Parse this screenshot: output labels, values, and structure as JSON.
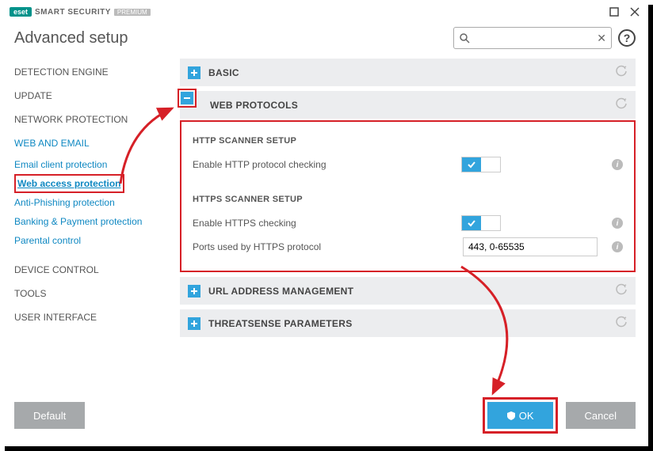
{
  "brand": {
    "badge": "eset",
    "name": "SMART SECURITY",
    "edition": "PREMIUM"
  },
  "page_title": "Advanced setup",
  "search": {
    "placeholder": ""
  },
  "sidebar": {
    "main": [
      "DETECTION ENGINE",
      "UPDATE",
      "NETWORK PROTECTION",
      "WEB AND EMAIL"
    ],
    "subs": [
      "Email client protection",
      "Web access protection",
      "Anti-Phishing protection",
      "Banking & Payment protection",
      "Parental control"
    ],
    "main2": [
      "DEVICE CONTROL",
      "TOOLS",
      "USER INTERFACE"
    ]
  },
  "sections": {
    "basic": "BASIC",
    "web_protocols": {
      "title": "WEB PROTOCOLS",
      "http": {
        "heading": "HTTP SCANNER SETUP",
        "enable_label": "Enable HTTP protocol checking"
      },
      "https": {
        "heading": "HTTPS SCANNER SETUP",
        "enable_label": "Enable HTTPS checking",
        "ports_label": "Ports used by HTTPS protocol",
        "ports_value": "443, 0-65535"
      }
    },
    "url_mgmt": "URL ADDRESS MANAGEMENT",
    "threatsense": "THREATSENSE PARAMETERS"
  },
  "buttons": {
    "default": "Default",
    "ok": "OK",
    "cancel": "Cancel"
  }
}
